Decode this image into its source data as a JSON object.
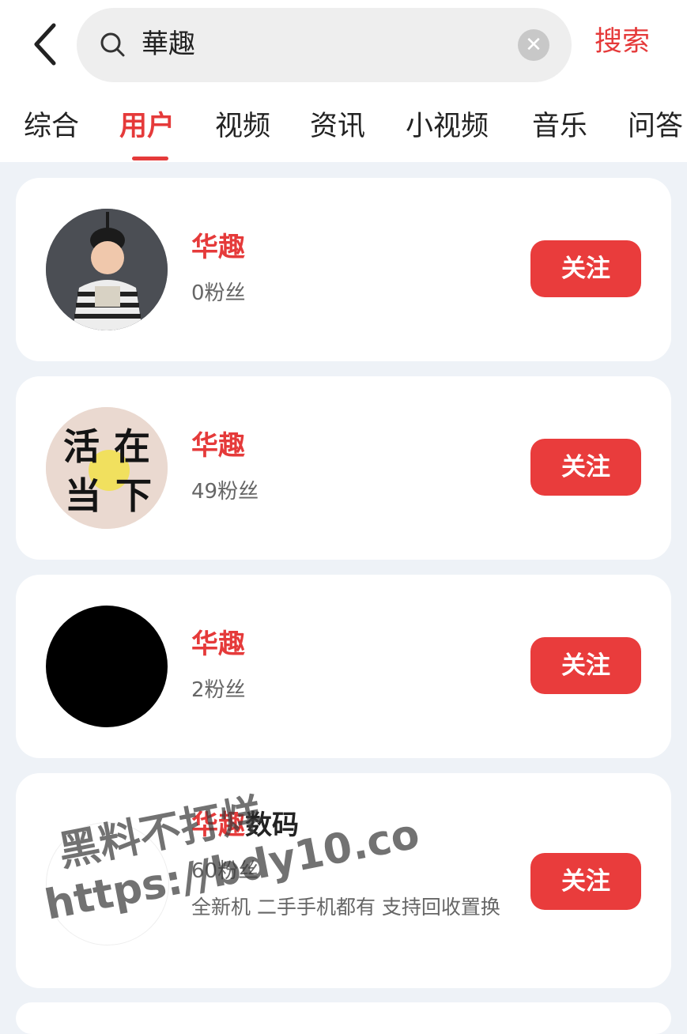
{
  "search": {
    "query": "華趣",
    "clear_icon": "close-icon",
    "search_label": "搜索"
  },
  "tabs": [
    {
      "label": "综合"
    },
    {
      "label": "用户",
      "active": true
    },
    {
      "label": "视频"
    },
    {
      "label": "资讯"
    },
    {
      "label": "小视频"
    },
    {
      "label": "音乐"
    },
    {
      "label": "问答"
    }
  ],
  "users": [
    {
      "name": "华趣",
      "fans": "0粉丝",
      "follow_label": "关注",
      "avatar": "photo-child"
    },
    {
      "name": "华趣",
      "fans": "49粉丝",
      "follow_label": "关注",
      "avatar": "calligraphy",
      "avatar_text": [
        "活",
        "在",
        "当",
        "下"
      ]
    },
    {
      "name": "华趣",
      "fans": "2粉丝",
      "follow_label": "关注",
      "avatar": "black-circle"
    },
    {
      "name_highlight": "华趣",
      "name_rest": "数码",
      "fans": "60粉丝",
      "description": "全新机 二手手机都有 支持回收置换",
      "follow_label": "关注",
      "avatar": "white-circle"
    }
  ],
  "watermark": {
    "line1": "黑料不打烊",
    "line2": "https://bdy10.co"
  },
  "colors": {
    "accent": "#e53a3a",
    "button": "#e93c3c",
    "page_bg": "#eef2f7"
  }
}
